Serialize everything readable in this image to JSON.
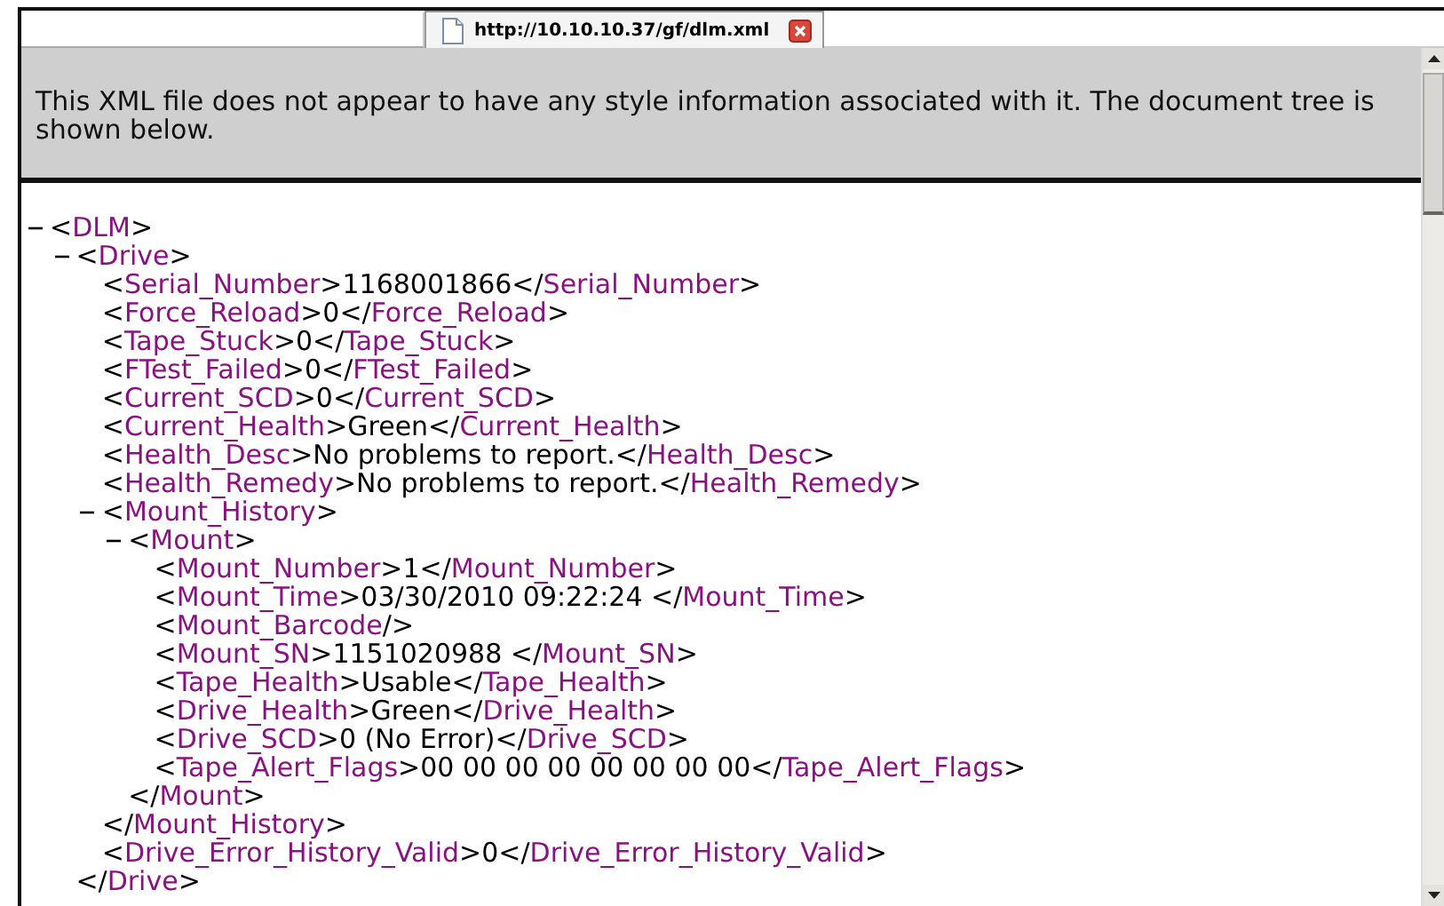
{
  "tab": {
    "title": "http://10.10.10.37/gf/dlm.xml"
  },
  "notice": "This XML file does not appear to have any style information associated with it. The document tree is shown below.",
  "tree": [
    {
      "kind": "parent",
      "open": "<DLM>",
      "expanded": true,
      "children": [
        {
          "kind": "parent",
          "open": "<Drive>",
          "close": "</Drive>",
          "expanded": true,
          "children": [
            {
              "kind": "leaf",
              "line": "<Serial_Number>1168001866</Serial_Number>"
            },
            {
              "kind": "leaf",
              "line": "<Force_Reload>0</Force_Reload>"
            },
            {
              "kind": "leaf",
              "line": "<Tape_Stuck>0</Tape_Stuck>"
            },
            {
              "kind": "leaf",
              "line": "<FTest_Failed>0</FTest_Failed>"
            },
            {
              "kind": "leaf",
              "line": "<Current_SCD>0</Current_SCD>"
            },
            {
              "kind": "leaf",
              "line": "<Current_Health>Green</Current_Health>"
            },
            {
              "kind": "leaf",
              "line": "<Health_Desc>No problems to report.</Health_Desc>"
            },
            {
              "kind": "leaf",
              "line": "<Health_Remedy>No problems to report.</Health_Remedy>"
            },
            {
              "kind": "parent",
              "open": "<Mount_History>",
              "close": "</Mount_History>",
              "expanded": true,
              "children": [
                {
                  "kind": "parent",
                  "open": "<Mount>",
                  "close": "</Mount>",
                  "expanded": true,
                  "children": [
                    {
                      "kind": "leaf",
                      "line": "<Mount_Number>1</Mount_Number>"
                    },
                    {
                      "kind": "leaf",
                      "line": "<Mount_Time>03/30/2010 09:22:24 </Mount_Time>"
                    },
                    {
                      "kind": "leaf",
                      "line": "<Mount_Barcode/>"
                    },
                    {
                      "kind": "leaf",
                      "line": "<Mount_SN>1151020988 </Mount_SN>"
                    },
                    {
                      "kind": "leaf",
                      "line": "<Tape_Health>Usable</Tape_Health>"
                    },
                    {
                      "kind": "leaf",
                      "line": "<Drive_Health>Green</Drive_Health>"
                    },
                    {
                      "kind": "leaf",
                      "line": "<Drive_SCD>0 (No Error)</Drive_SCD>"
                    },
                    {
                      "kind": "leaf",
                      "line": "<Tape_Alert_Flags>00 00 00 00 00 00 00 00</Tape_Alert_Flags>"
                    }
                  ]
                }
              ]
            },
            {
              "kind": "leaf",
              "line": "<Drive_Error_History_Valid>0</Drive_Error_History_Valid>"
            }
          ]
        }
      ]
    }
  ]
}
